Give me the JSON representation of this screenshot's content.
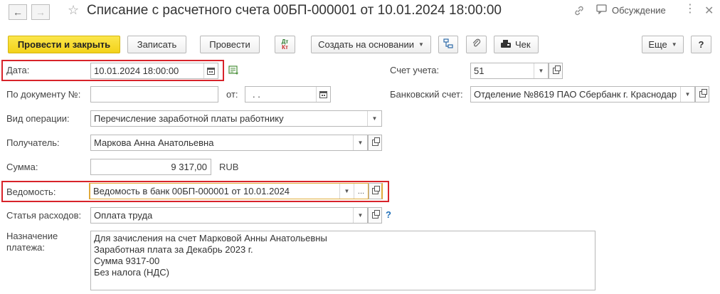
{
  "header": {
    "title": "Списание с расчетного счета 00БП-000001 от 10.01.2024 18:00:00",
    "discuss_label": "Обсуждение",
    "back_icon": "arrow-left-icon",
    "forward_icon": "arrow-right-icon"
  },
  "toolbar": {
    "post_close": "Провести и закрыть",
    "save": "Записать",
    "post": "Провести",
    "dt_kt_top": "Дт",
    "dt_kt_bottom": "Кт",
    "create_based": "Создать на основании",
    "receipt": "Чек",
    "more": "Еще",
    "help": "?"
  },
  "form": {
    "date": {
      "label": "Дата:",
      "value": "10.01.2024 18:00:00"
    },
    "account": {
      "label": "Счет учета:",
      "value": "51"
    },
    "doc_number": {
      "label": "По документу №:",
      "value": ""
    },
    "from": {
      "label": "от:",
      "value": " .  ."
    },
    "bank_account": {
      "label": "Банковский счет:",
      "value": "Отделение №8619 ПАО Сбербанк г. Краснодар"
    },
    "operation": {
      "label": "Вид операции:",
      "value": "Перечисление заработной платы работнику"
    },
    "recipient": {
      "label": "Получатель:",
      "value": "Маркова Анна Анатольевна"
    },
    "amount": {
      "label": "Сумма:",
      "value": "9 317,00",
      "currency": "RUB"
    },
    "statement": {
      "label": "Ведомость:",
      "value": "Ведомость в банк 00БП-000001 от 10.01.2024"
    },
    "expense_item": {
      "label": "Статья расходов:",
      "value": "Оплата труда",
      "help": "?"
    },
    "purpose": {
      "label_line1": "Назначение",
      "label_line2": "платежа:",
      "lines": [
        "Для зачисления на счет Марковой Анны Анатольевны",
        "Заработная плата за Декабрь 2023 г.",
        "Сумма 9317-00",
        "Без налога (НДС)"
      ]
    }
  },
  "colors": {
    "primary_button": "#f3d21a",
    "highlight_border": "#d8232a",
    "help_link": "#1f6fb8"
  }
}
